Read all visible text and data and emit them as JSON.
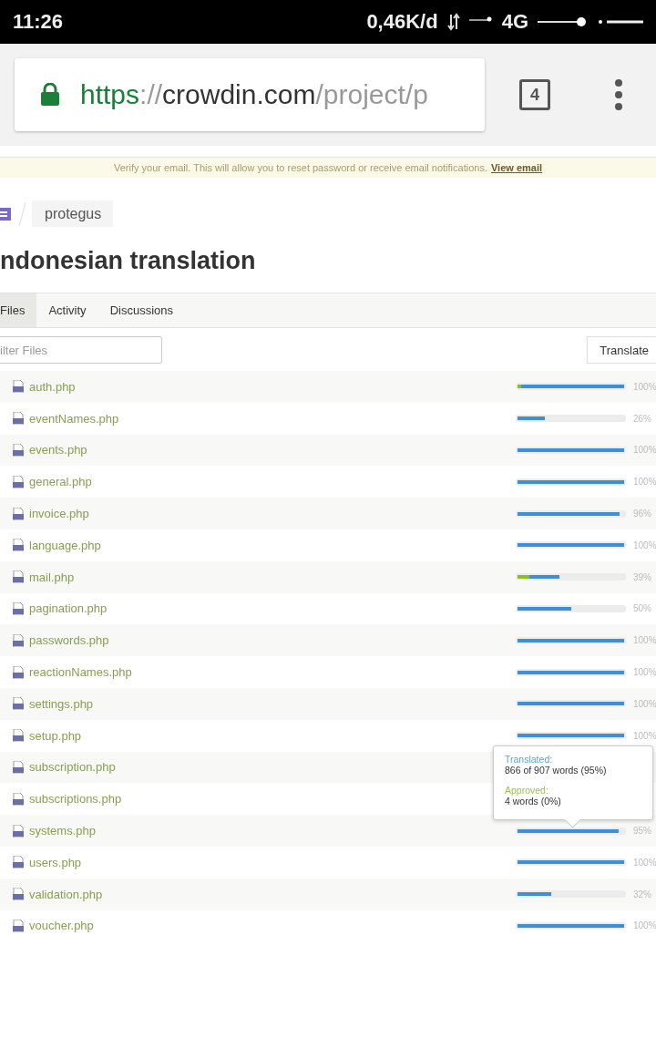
{
  "status_bar": {
    "time": "11:26",
    "network_speed": "0,46K/d",
    "network_type": "4G"
  },
  "browser": {
    "url": {
      "scheme": "https",
      "separator": "://",
      "host": "crowdin.com",
      "path": "/project/p"
    },
    "tab_count": "4"
  },
  "banner": {
    "text": "Verify your email. This will allow you to reset password or receive email notifications.",
    "link": "View email"
  },
  "breadcrumb": {
    "project": "protegus"
  },
  "title": "ndonesian translation",
  "tabs": [
    {
      "label": "Files",
      "selected": true
    },
    {
      "label": "Activity",
      "selected": false
    },
    {
      "label": "Discussions",
      "selected": false
    }
  ],
  "filter": {
    "placeholder": "ilter Files"
  },
  "translate_button": "Translate",
  "files": [
    {
      "name": "auth.php",
      "bar": [
        {
          "kind": "approved",
          "level": 0.03
        },
        {
          "kind": "translated",
          "level": 0.97
        }
      ],
      "percent": "100%"
    },
    {
      "name": "eventNames.php",
      "bar": [
        {
          "kind": "translated",
          "level": 0.26
        }
      ],
      "percent": "26%"
    },
    {
      "name": "events.php",
      "bar": [
        {
          "kind": "translated",
          "level": 1
        }
      ],
      "percent": "100%"
    },
    {
      "name": "general.php",
      "bar": [
        {
          "kind": "translated",
          "level": 1
        }
      ],
      "percent": "100%"
    },
    {
      "name": "invoice.php",
      "bar": [
        {
          "kind": "translated",
          "level": 0.96
        }
      ],
      "percent": "96%"
    },
    {
      "name": "language.php",
      "bar": [
        {
          "kind": "translated",
          "level": 1
        }
      ],
      "percent": "100%"
    },
    {
      "name": "mail.php",
      "bar": [
        {
          "kind": "approved",
          "level": 0.11
        },
        {
          "kind": "translated",
          "level": 0.28
        }
      ],
      "percent": "39%"
    },
    {
      "name": "pagination.php",
      "bar": [
        {
          "kind": "translated",
          "level": 0.5
        }
      ],
      "percent": "50%"
    },
    {
      "name": "passwords.php",
      "bar": [
        {
          "kind": "translated",
          "level": 1
        }
      ],
      "percent": "100%"
    },
    {
      "name": "reactionNames.php",
      "bar": [
        {
          "kind": "translated",
          "level": 1
        }
      ],
      "percent": "100%"
    },
    {
      "name": "settings.php",
      "bar": [
        {
          "kind": "translated",
          "level": 1
        }
      ],
      "percent": "100%"
    },
    {
      "name": "setup.php",
      "bar": [
        {
          "kind": "translated",
          "level": 1
        }
      ],
      "percent": "100%"
    },
    {
      "name": "subscription.php"
    },
    {
      "name": "subscriptions.php"
    },
    {
      "name": "systems.php",
      "bar": [
        {
          "kind": "translated",
          "level": 0.95
        }
      ],
      "percent": "95%"
    },
    {
      "name": "users.php",
      "bar": [
        {
          "kind": "translated",
          "level": 1
        }
      ],
      "percent": "100%"
    },
    {
      "name": "validation.php",
      "bar": [
        {
          "kind": "translated",
          "level": 0.32
        }
      ],
      "percent": "32%"
    },
    {
      "name": "voucher.php",
      "bar": [
        {
          "kind": "translated",
          "level": 1
        }
      ],
      "percent": "100%"
    }
  ],
  "tooltip": {
    "translated_label": "Translated:",
    "translated_value": "866 of 907 words (95%)",
    "approved_label": "Approved:",
    "approved_value": "4 words (0%)"
  }
}
